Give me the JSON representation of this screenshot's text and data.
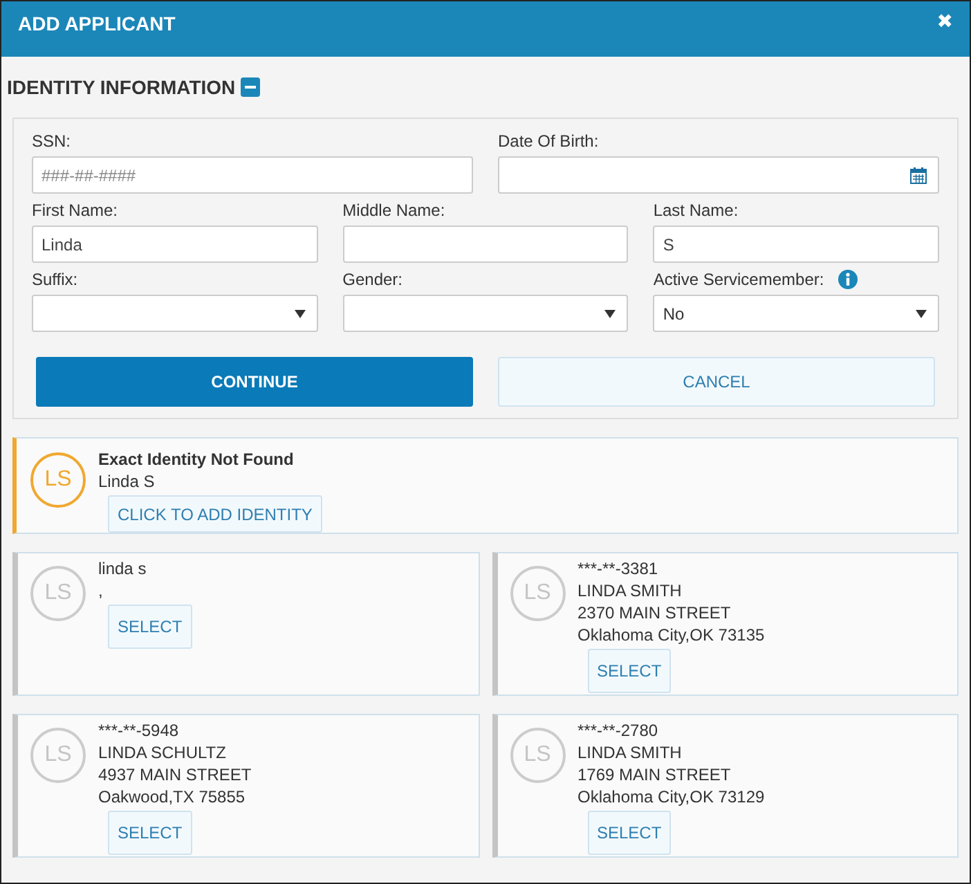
{
  "window": {
    "title": "ADD APPLICANT",
    "close": "✖"
  },
  "section": {
    "title": "IDENTITY INFORMATION",
    "expanded": true
  },
  "form": {
    "rows": [
      [
        {
          "label": "SSN:",
          "kind": "text",
          "placeholder": "###-##-####"
        },
        {
          "label": "Date Of Birth:",
          "kind": "date"
        }
      ],
      [
        {
          "label": "First Name:",
          "kind": "text",
          "value": "Linda"
        },
        {
          "label": "Middle Name:",
          "kind": "text"
        },
        {
          "label": "Last Name:",
          "kind": "text",
          "value": "S"
        }
      ],
      [
        {
          "label": "Suffix:",
          "kind": "select"
        },
        {
          "label": "Gender:",
          "kind": "select"
        },
        {
          "label": "Active Servicemember:",
          "kind": "select",
          "value": "No",
          "info": true
        }
      ]
    ]
  },
  "buttons": [
    {
      "label": "CONTINUE",
      "kind": "primary"
    },
    {
      "label": "CANCEL",
      "kind": "secondary"
    }
  ],
  "not_found": {
    "initials": "LS",
    "title": "Exact Identity Not Found",
    "name": "Linda S",
    "button": "CLICK TO ADD IDENTITY"
  },
  "results": [
    {
      "initials": "LS",
      "lines": [
        "linda s",
        ","
      ],
      "button": "SELECT"
    },
    {
      "initials": "LS",
      "lines": [
        "***-**-3381",
        "LINDA SMITH",
        "2370 MAIN STREET",
        "Oklahoma City,OK 73135"
      ],
      "button": "SELECT"
    },
    {
      "initials": "LS",
      "lines": [
        "***-**-5948",
        "LINDA SCHULTZ",
        "4937 MAIN STREET",
        "Oakwood,TX 75855"
      ],
      "button": "SELECT"
    },
    {
      "initials": "LS",
      "lines": [
        "***-**-2780",
        "LINDA SMITH",
        "1769 MAIN STREET",
        "Oklahoma City,OK 73129"
      ],
      "button": "SELECT"
    }
  ]
}
